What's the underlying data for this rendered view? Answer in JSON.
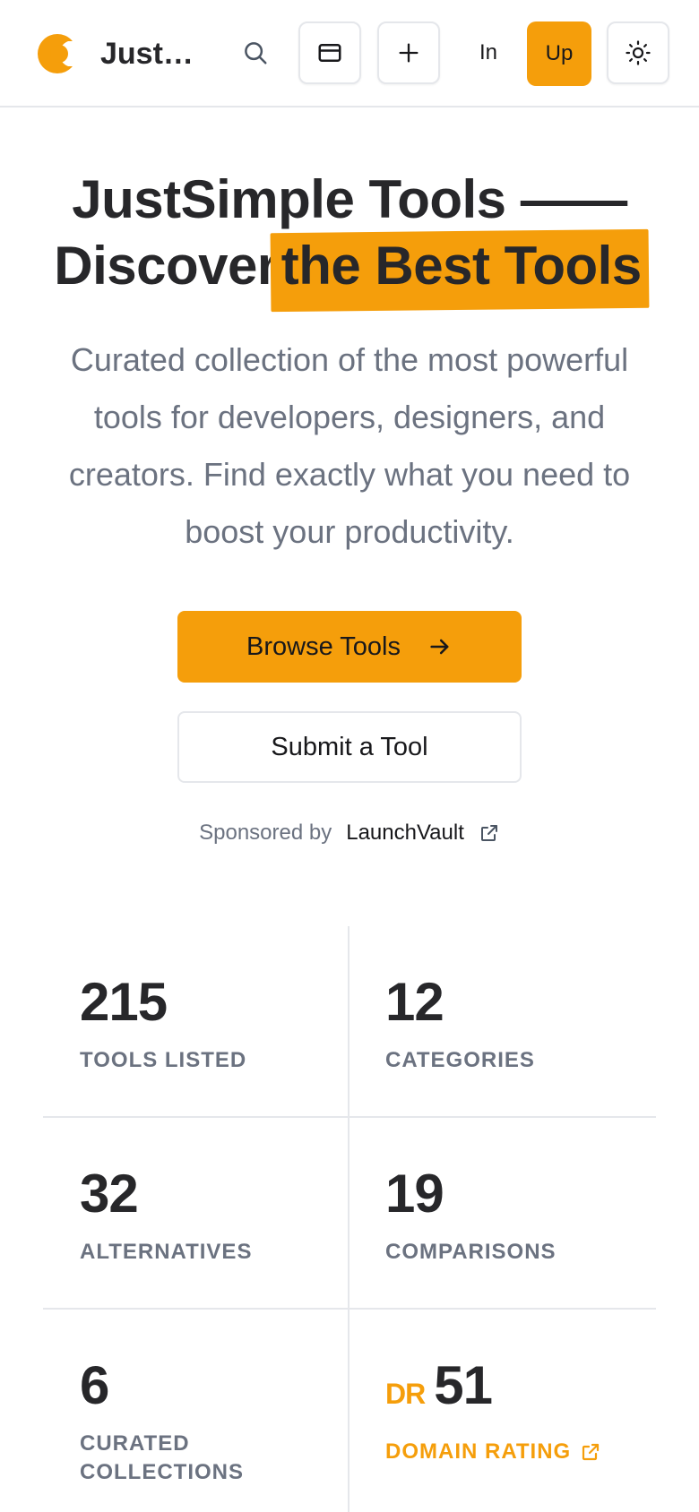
{
  "header": {
    "brand": "Just…",
    "signin_label": "In",
    "signup_label": "Up",
    "icons": [
      "logo",
      "search-icon",
      "card-icon",
      "plus-icon",
      "sun-icon"
    ],
    "accent_color": "#f59e0b"
  },
  "hero": {
    "title_part1": "JustSimple Tools ——",
    "title_part2": "Discover",
    "title_highlight": "the Best Tools",
    "subtitle": "Curated collection of the most powerful tools for developers, designers, and creators. Find exactly what you need to boost your productivity.",
    "browse_label": "Browse Tools",
    "submit_label": "Submit a Tool",
    "sponsor_prefix": "Sponsored by",
    "sponsor_name": "LaunchVault"
  },
  "stats": {
    "tools": {
      "value": "215",
      "label": "TOOLS LISTED"
    },
    "categories": {
      "value": "12",
      "label": "CATEGORIES"
    },
    "alternatives": {
      "value": "32",
      "label": "ALTERNATIVES"
    },
    "comparisons": {
      "value": "19",
      "label": "COMPARISONS"
    },
    "collections": {
      "value": "6",
      "label_line1": "CURATED",
      "label_line2": "COLLECTIONS"
    },
    "domain_rating": {
      "prefix": "DR",
      "value": "51",
      "label": "DOMAIN RATING"
    }
  }
}
